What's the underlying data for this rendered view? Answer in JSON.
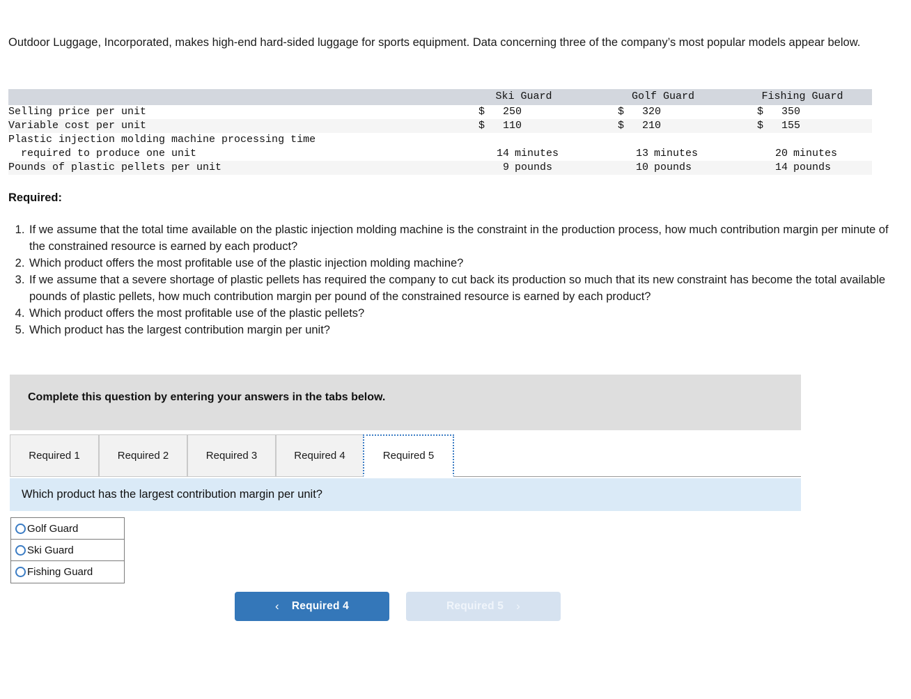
{
  "intro": {
    "paragraph": "Outdoor Luggage, Incorporated, makes high-end hard-sided luggage for sports equipment. Data concerning three of the company’s most popular models appear below."
  },
  "table": {
    "blank_header": "",
    "columns": [
      "Ski Guard",
      "Golf Guard",
      "Fishing Guard"
    ],
    "rows": [
      {
        "label": "Selling price per unit",
        "currency": [
          "$",
          "$",
          "$"
        ],
        "values": [
          "250",
          "320",
          "350"
        ],
        "units": [
          "",
          "",
          ""
        ]
      },
      {
        "label": "Variable cost per unit",
        "currency": [
          "$",
          "$",
          "$"
        ],
        "values": [
          "110",
          "210",
          "155"
        ],
        "units": [
          "",
          "",
          ""
        ]
      },
      {
        "label": "Plastic injection molding machine processing time",
        "label_line2": "  required to produce one unit",
        "currency": [
          "",
          "",
          ""
        ],
        "values": [
          "14",
          "13",
          "20"
        ],
        "units": [
          "minutes",
          "minutes",
          "minutes"
        ]
      },
      {
        "label": "Pounds of plastic pellets per unit",
        "currency": [
          "",
          "",
          ""
        ],
        "values": [
          "9",
          "10",
          "14"
        ],
        "units": [
          "pounds",
          "pounds",
          "pounds"
        ]
      }
    ]
  },
  "required": {
    "heading": "Required:",
    "items": [
      "If we assume that the total time available on the plastic injection molding machine is the constraint in the production process, how much contribution margin per minute of the constrained resource is earned by each product?",
      "Which product offers the most profitable use of the plastic injection molding machine?",
      "If we assume that a severe shortage of plastic pellets has required the company to cut back its production so much that its new constraint has become the total available pounds of plastic pellets, how much contribution margin per pound of the constrained resource is earned by each product?",
      "Which product offers the most profitable use of the plastic pellets?",
      "Which product has the largest contribution margin per unit?"
    ]
  },
  "instruction_banner": {
    "text": "Complete this question by entering your answers in the tabs below."
  },
  "tabs": {
    "items": [
      {
        "label": "Required 1",
        "active": false
      },
      {
        "label": "Required 2",
        "active": false
      },
      {
        "label": "Required 3",
        "active": false
      },
      {
        "label": "Required 4",
        "active": false
      },
      {
        "label": "Required 5",
        "active": true
      }
    ]
  },
  "question": {
    "text": "Which product has the largest contribution margin per unit?"
  },
  "answer_options": [
    {
      "label": "Golf Guard",
      "selected": false
    },
    {
      "label": "Ski Guard",
      "selected": false
    },
    {
      "label": "Fishing Guard",
      "selected": false
    }
  ],
  "navigation": {
    "prev_label": "Required 4",
    "prev_chevron": "‹",
    "next_label": "Required 5",
    "next_chevron": "›",
    "prev_enabled": true,
    "next_enabled": false
  },
  "colors": {
    "table_header_bg": "#d3d7de",
    "row_shade": "#f5f5f5",
    "instruction_bg": "#dedede",
    "question_bg": "#daeaf7",
    "accent_blue": "#3477b9",
    "disabled_blue": "#d6e2f0",
    "radio_blue": "#3b7cc4"
  }
}
